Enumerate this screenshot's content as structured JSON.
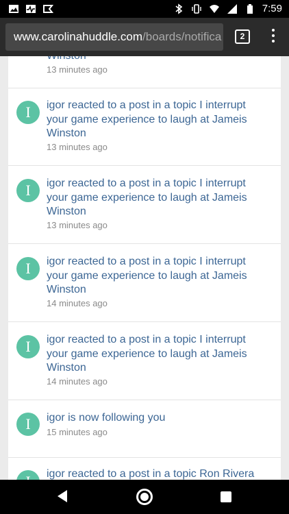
{
  "status_bar": {
    "time": "7:59",
    "left_icons": [
      "image-icon",
      "pulse-icon",
      "play-store-icon"
    ],
    "right_icons": [
      "bluetooth-icon",
      "vibrate-icon",
      "wifi-icon",
      "signal-icon",
      "battery-icon"
    ]
  },
  "browser": {
    "url_domain": "www.carolinahuddle.com",
    "url_path": "/boards/notifica",
    "tab_count": "2"
  },
  "notifications": [
    {
      "text": "Winston",
      "time": "13 minutes ago",
      "avatar_letter": "I"
    },
    {
      "text": "igor reacted to a post in a topic I interrupt your game experience to laugh at Jameis Winston",
      "time": "13 minutes ago",
      "avatar_letter": "I"
    },
    {
      "text": "igor reacted to a post in a topic I interrupt your game experience to laugh at Jameis Winston",
      "time": "13 minutes ago",
      "avatar_letter": "I"
    },
    {
      "text": "igor reacted to a post in a topic I interrupt your game experience to laugh at Jameis Winston",
      "time": "14 minutes ago",
      "avatar_letter": "I"
    },
    {
      "text": "igor reacted to a post in a topic I interrupt your game experience to laugh at Jameis Winston",
      "time": "14 minutes ago",
      "avatar_letter": "I"
    },
    {
      "text": "igor is now following you",
      "time": "15 minutes ago",
      "avatar_letter": "I"
    },
    {
      "text": "igor reacted to a post in a topic Ron Rivera",
      "time": "",
      "avatar_letter": "I"
    }
  ],
  "colors": {
    "avatar_bg": "#5cc3a4",
    "link": "#3c6694",
    "chrome_bar": "#2b2b2b"
  }
}
